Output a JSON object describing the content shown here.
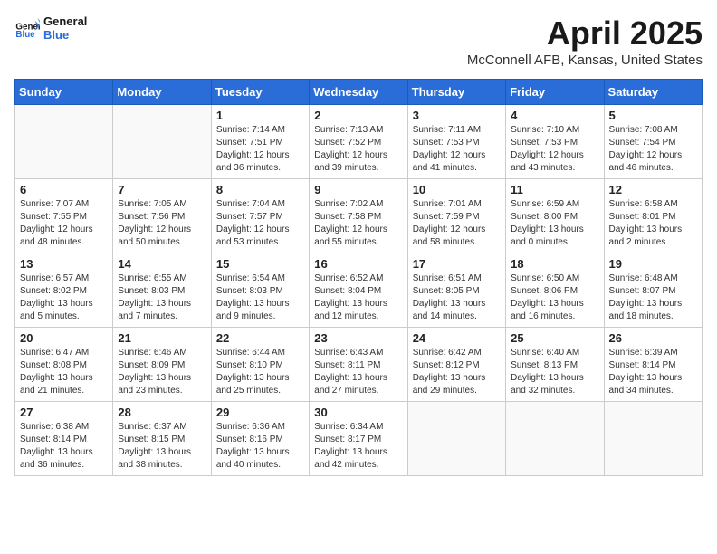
{
  "header": {
    "logo_general": "General",
    "logo_blue": "Blue",
    "title": "April 2025",
    "subtitle": "McConnell AFB, Kansas, United States"
  },
  "weekdays": [
    "Sunday",
    "Monday",
    "Tuesday",
    "Wednesday",
    "Thursday",
    "Friday",
    "Saturday"
  ],
  "weeks": [
    [
      {
        "day": "",
        "info": ""
      },
      {
        "day": "",
        "info": ""
      },
      {
        "day": "1",
        "info": "Sunrise: 7:14 AM\nSunset: 7:51 PM\nDaylight: 12 hours and 36 minutes."
      },
      {
        "day": "2",
        "info": "Sunrise: 7:13 AM\nSunset: 7:52 PM\nDaylight: 12 hours and 39 minutes."
      },
      {
        "day": "3",
        "info": "Sunrise: 7:11 AM\nSunset: 7:53 PM\nDaylight: 12 hours and 41 minutes."
      },
      {
        "day": "4",
        "info": "Sunrise: 7:10 AM\nSunset: 7:53 PM\nDaylight: 12 hours and 43 minutes."
      },
      {
        "day": "5",
        "info": "Sunrise: 7:08 AM\nSunset: 7:54 PM\nDaylight: 12 hours and 46 minutes."
      }
    ],
    [
      {
        "day": "6",
        "info": "Sunrise: 7:07 AM\nSunset: 7:55 PM\nDaylight: 12 hours and 48 minutes."
      },
      {
        "day": "7",
        "info": "Sunrise: 7:05 AM\nSunset: 7:56 PM\nDaylight: 12 hours and 50 minutes."
      },
      {
        "day": "8",
        "info": "Sunrise: 7:04 AM\nSunset: 7:57 PM\nDaylight: 12 hours and 53 minutes."
      },
      {
        "day": "9",
        "info": "Sunrise: 7:02 AM\nSunset: 7:58 PM\nDaylight: 12 hours and 55 minutes."
      },
      {
        "day": "10",
        "info": "Sunrise: 7:01 AM\nSunset: 7:59 PM\nDaylight: 12 hours and 58 minutes."
      },
      {
        "day": "11",
        "info": "Sunrise: 6:59 AM\nSunset: 8:00 PM\nDaylight: 13 hours and 0 minutes."
      },
      {
        "day": "12",
        "info": "Sunrise: 6:58 AM\nSunset: 8:01 PM\nDaylight: 13 hours and 2 minutes."
      }
    ],
    [
      {
        "day": "13",
        "info": "Sunrise: 6:57 AM\nSunset: 8:02 PM\nDaylight: 13 hours and 5 minutes."
      },
      {
        "day": "14",
        "info": "Sunrise: 6:55 AM\nSunset: 8:03 PM\nDaylight: 13 hours and 7 minutes."
      },
      {
        "day": "15",
        "info": "Sunrise: 6:54 AM\nSunset: 8:03 PM\nDaylight: 13 hours and 9 minutes."
      },
      {
        "day": "16",
        "info": "Sunrise: 6:52 AM\nSunset: 8:04 PM\nDaylight: 13 hours and 12 minutes."
      },
      {
        "day": "17",
        "info": "Sunrise: 6:51 AM\nSunset: 8:05 PM\nDaylight: 13 hours and 14 minutes."
      },
      {
        "day": "18",
        "info": "Sunrise: 6:50 AM\nSunset: 8:06 PM\nDaylight: 13 hours and 16 minutes."
      },
      {
        "day": "19",
        "info": "Sunrise: 6:48 AM\nSunset: 8:07 PM\nDaylight: 13 hours and 18 minutes."
      }
    ],
    [
      {
        "day": "20",
        "info": "Sunrise: 6:47 AM\nSunset: 8:08 PM\nDaylight: 13 hours and 21 minutes."
      },
      {
        "day": "21",
        "info": "Sunrise: 6:46 AM\nSunset: 8:09 PM\nDaylight: 13 hours and 23 minutes."
      },
      {
        "day": "22",
        "info": "Sunrise: 6:44 AM\nSunset: 8:10 PM\nDaylight: 13 hours and 25 minutes."
      },
      {
        "day": "23",
        "info": "Sunrise: 6:43 AM\nSunset: 8:11 PM\nDaylight: 13 hours and 27 minutes."
      },
      {
        "day": "24",
        "info": "Sunrise: 6:42 AM\nSunset: 8:12 PM\nDaylight: 13 hours and 29 minutes."
      },
      {
        "day": "25",
        "info": "Sunrise: 6:40 AM\nSunset: 8:13 PM\nDaylight: 13 hours and 32 minutes."
      },
      {
        "day": "26",
        "info": "Sunrise: 6:39 AM\nSunset: 8:14 PM\nDaylight: 13 hours and 34 minutes."
      }
    ],
    [
      {
        "day": "27",
        "info": "Sunrise: 6:38 AM\nSunset: 8:14 PM\nDaylight: 13 hours and 36 minutes."
      },
      {
        "day": "28",
        "info": "Sunrise: 6:37 AM\nSunset: 8:15 PM\nDaylight: 13 hours and 38 minutes."
      },
      {
        "day": "29",
        "info": "Sunrise: 6:36 AM\nSunset: 8:16 PM\nDaylight: 13 hours and 40 minutes."
      },
      {
        "day": "30",
        "info": "Sunrise: 6:34 AM\nSunset: 8:17 PM\nDaylight: 13 hours and 42 minutes."
      },
      {
        "day": "",
        "info": ""
      },
      {
        "day": "",
        "info": ""
      },
      {
        "day": "",
        "info": ""
      }
    ]
  ]
}
